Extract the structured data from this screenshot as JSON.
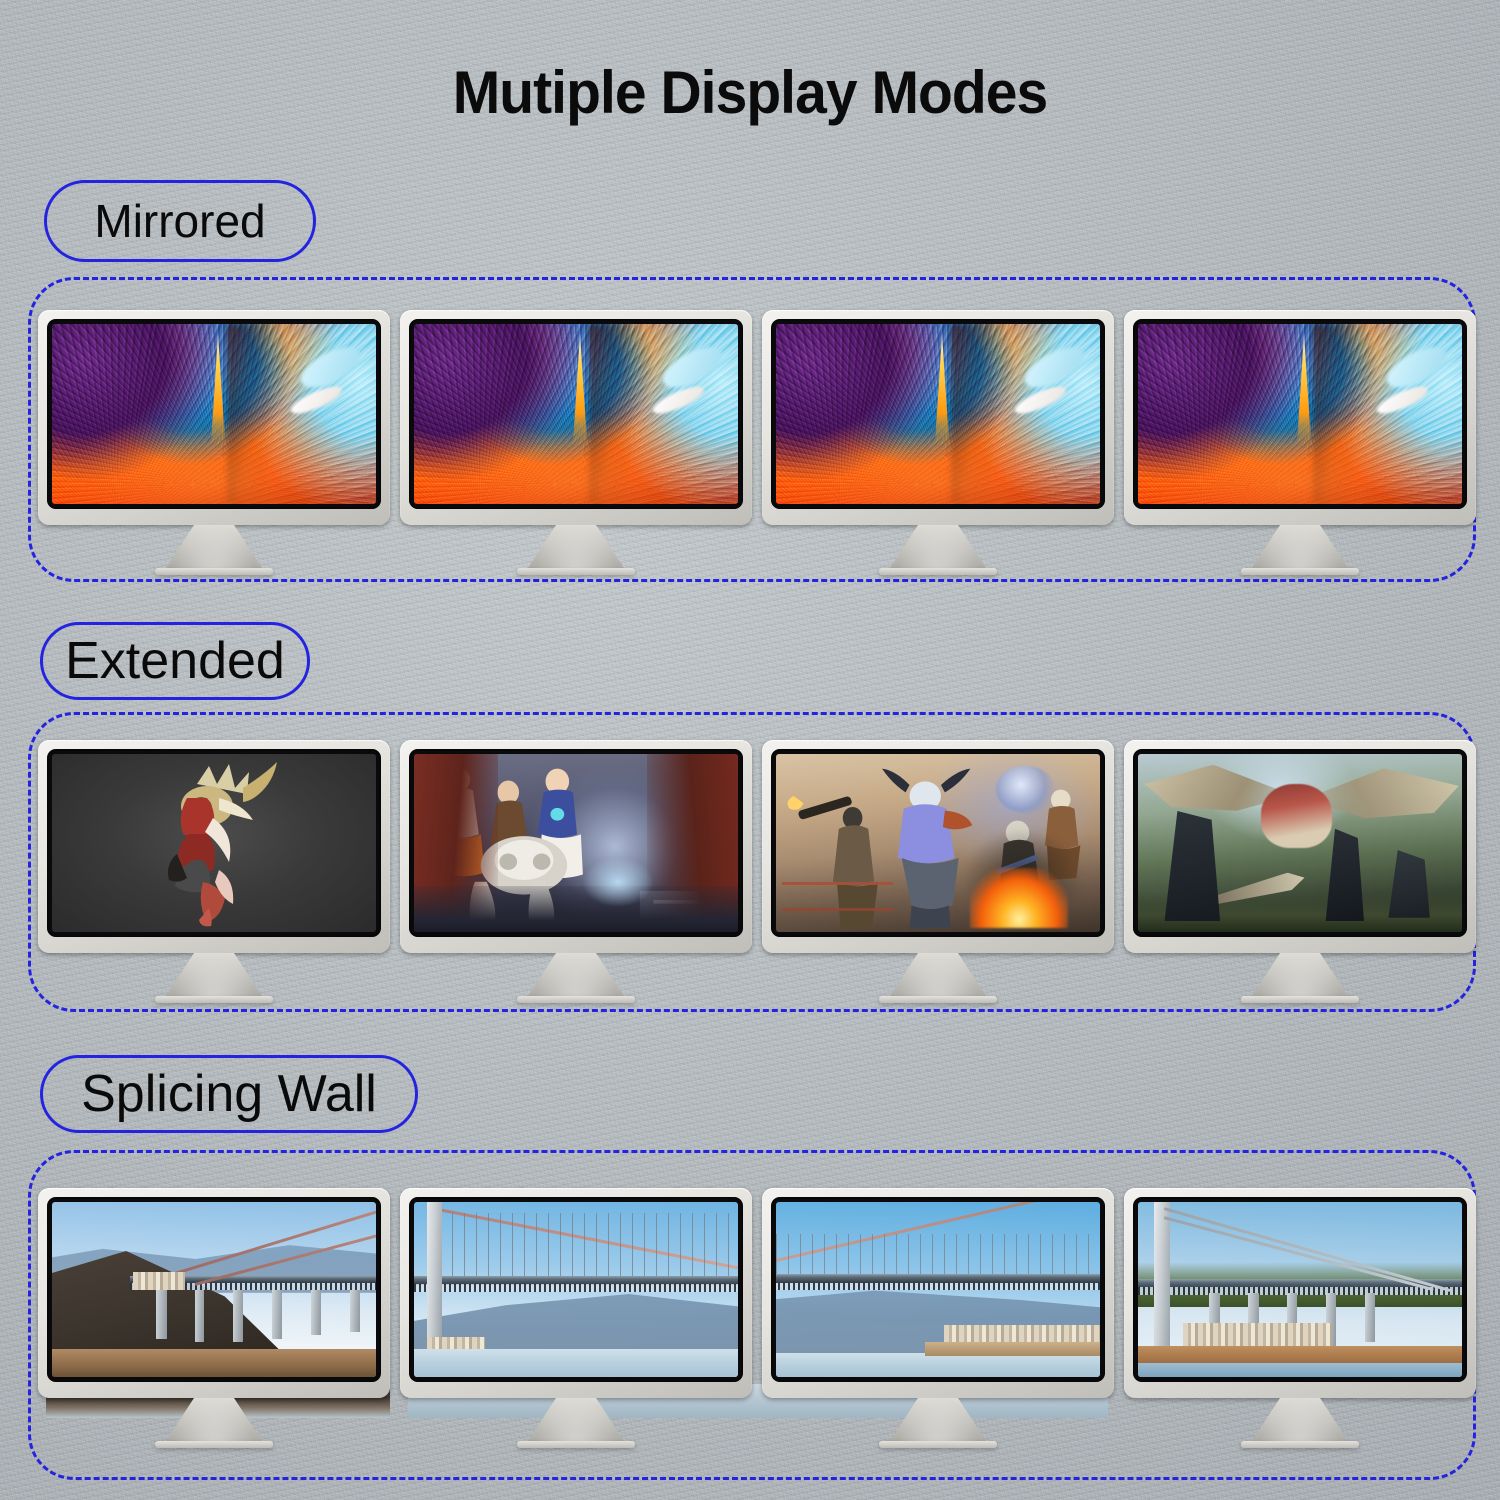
{
  "title": "Mutiple Display Modes",
  "theme": {
    "background": "#b9bfc3",
    "accent_blue": "#2323e0",
    "title_color": "#0b0b0b",
    "bezel_light": "#f3f2ef",
    "bezel_dark": "#0b0b0d"
  },
  "sections": [
    {
      "id": "mirrored",
      "label": "Mirrored",
      "monitor_count": 4,
      "screens": [
        {
          "name": "abstract-swirl-wallpaper",
          "art": "swirl",
          "description": "Colorful abstract ribbon wallpaper"
        },
        {
          "name": "abstract-swirl-wallpaper",
          "art": "swirl",
          "description": "Colorful abstract ribbon wallpaper"
        },
        {
          "name": "abstract-swirl-wallpaper",
          "art": "swirl",
          "description": "Colorful abstract ribbon wallpaper"
        },
        {
          "name": "abstract-swirl-wallpaper",
          "art": "swirl",
          "description": "Colorful abstract ribbon wallpaper"
        }
      ]
    },
    {
      "id": "extended",
      "label": "Extended",
      "monitor_count": 4,
      "screens": [
        {
          "name": "armored-hunter-character",
          "art": "mh1",
          "description": "Armored character on dark background"
        },
        {
          "name": "hero-shooter-squad",
          "art": "ow",
          "description": "Hero shooter characters with mech in sci-fi corridor"
        },
        {
          "name": "sci-fi-battle-scene",
          "art": "dest",
          "description": "Sci-fi guardians battling with fire and explosions"
        },
        {
          "name": "dragon-hunt-scene",
          "art": "mhw",
          "description": "Hunters fighting a winged dragon in a forest"
        }
      ]
    },
    {
      "id": "splicing-wall",
      "label": "Splicing Wall",
      "monitor_count": 4,
      "screens": [
        {
          "name": "bridge-panorama-slice-1",
          "art": "br1",
          "description": "Suspension bridge approach with hillside"
        },
        {
          "name": "bridge-panorama-slice-2",
          "art": "br2",
          "description": "Bridge main span with tower and mountain"
        },
        {
          "name": "bridge-panorama-slice-3",
          "art": "br3",
          "description": "Bridge span over water with shoreline city"
        },
        {
          "name": "bridge-panorama-slice-4",
          "art": "br4",
          "description": "Bridge right tower and viaduct over town"
        }
      ]
    }
  ]
}
